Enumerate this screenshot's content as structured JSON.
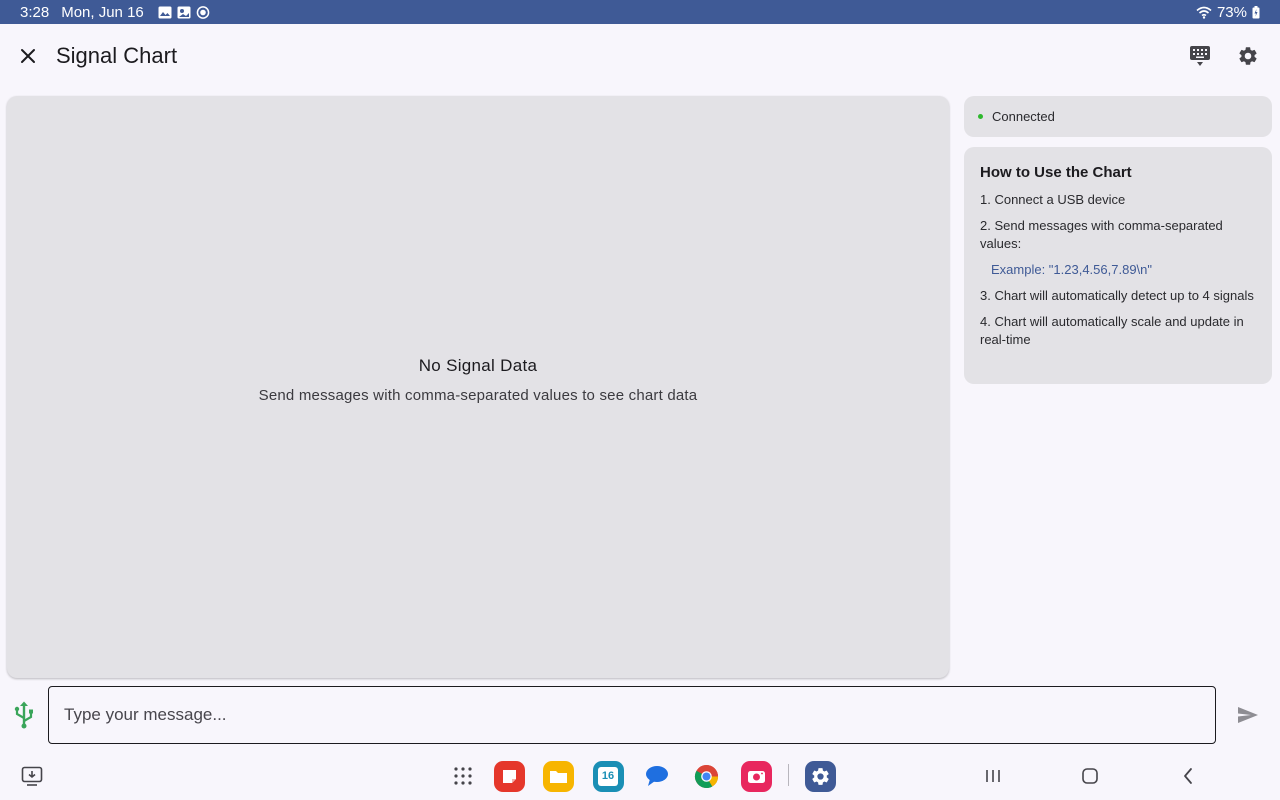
{
  "status_bar": {
    "time": "3:28",
    "date": "Mon, Jun 16",
    "battery": "73%",
    "icons": [
      "gallery-icon",
      "photo-icon",
      "app-notification-icon",
      "wifi-icon",
      "battery-charging-icon"
    ]
  },
  "app_bar": {
    "title": "Signal Chart",
    "close_icon": "close-icon",
    "actions": [
      "keyboard-icon",
      "settings-gear-icon"
    ]
  },
  "chart_panel": {
    "empty_title": "No Signal Data",
    "empty_subtitle": "Send messages with comma-separated values to see chart data"
  },
  "connection": {
    "status": "Connected",
    "dot_color": "#2eb82e"
  },
  "help": {
    "title": "How to Use the Chart",
    "step1": "1. Connect a USB device",
    "step2": "2. Send messages with comma-separated values:",
    "example": "Example: \"1.23,4.56,7.89\\n\"",
    "step3": "3. Chart will automatically detect up to 4 signals",
    "step4": "4. Chart will automatically scale and update in real-time"
  },
  "input": {
    "placeholder": "Type your message...",
    "value": ""
  },
  "nav_bar": {
    "apps": [
      "app-drawer-icon",
      "notes-app-icon",
      "files-app-icon",
      "calendar-app-icon",
      "messages-app-icon",
      "chrome-app-icon",
      "camera-app-icon",
      "settings-app-icon"
    ],
    "calendar_day": "16",
    "buttons": [
      "recents-button",
      "home-button",
      "back-button"
    ]
  },
  "colors": {
    "status_bar": "#3f5a96",
    "panel_bg": "#e3e2e6",
    "page_bg": "#f8f6fc",
    "accent": "#3f5a96",
    "usb_green": "#3aa55a"
  }
}
